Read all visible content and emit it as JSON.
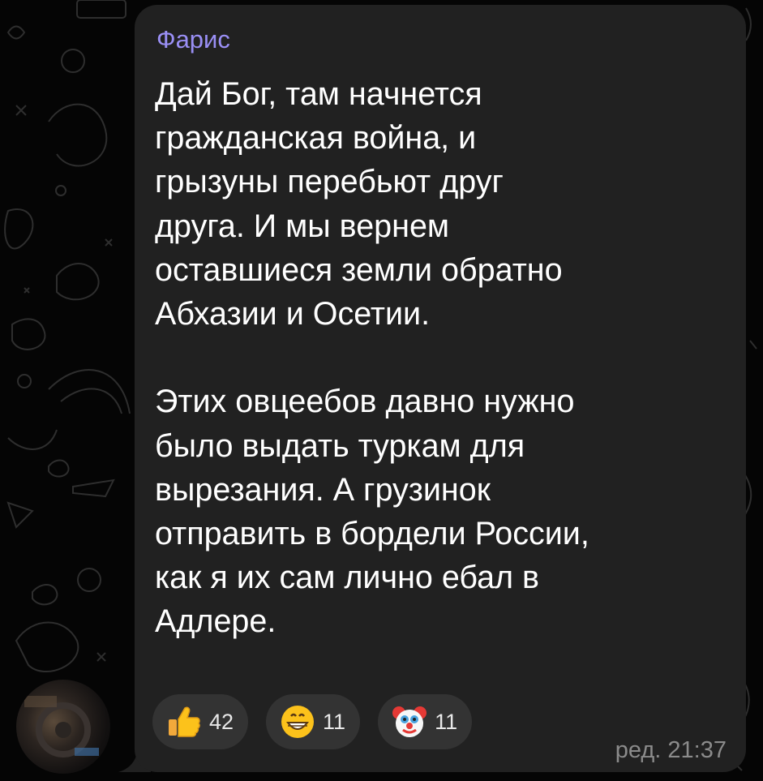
{
  "message": {
    "sender": "Фарис",
    "paragraph1_lines": [
      "Дай Бог, там начнется",
      "гражданская война, и",
      "грызуны перебьют друг",
      "друга. И мы вернем",
      "оставшиеся земли обратно",
      "Абхазии и Осетии."
    ],
    "paragraph2_lines": [
      "Этих овцеебов давно нужно",
      "было выдать туркам для",
      "вырезания. А грузинок",
      "отправить в бордели России,",
      "как я их сам лично ебал в",
      "Адлере."
    ],
    "meta": "ред. 21:37"
  },
  "reactions": [
    {
      "icon": "thumbs-up-icon",
      "count": "42"
    },
    {
      "icon": "grinning-face-icon",
      "count": "11"
    },
    {
      "icon": "clown-face-icon",
      "count": "11"
    }
  ],
  "colors": {
    "background": "#050505",
    "bubble": "#212121",
    "sender": "#9a8ff5",
    "text": "#ffffff",
    "reaction_pill": "#333333",
    "meta": "#8b8b8b"
  }
}
